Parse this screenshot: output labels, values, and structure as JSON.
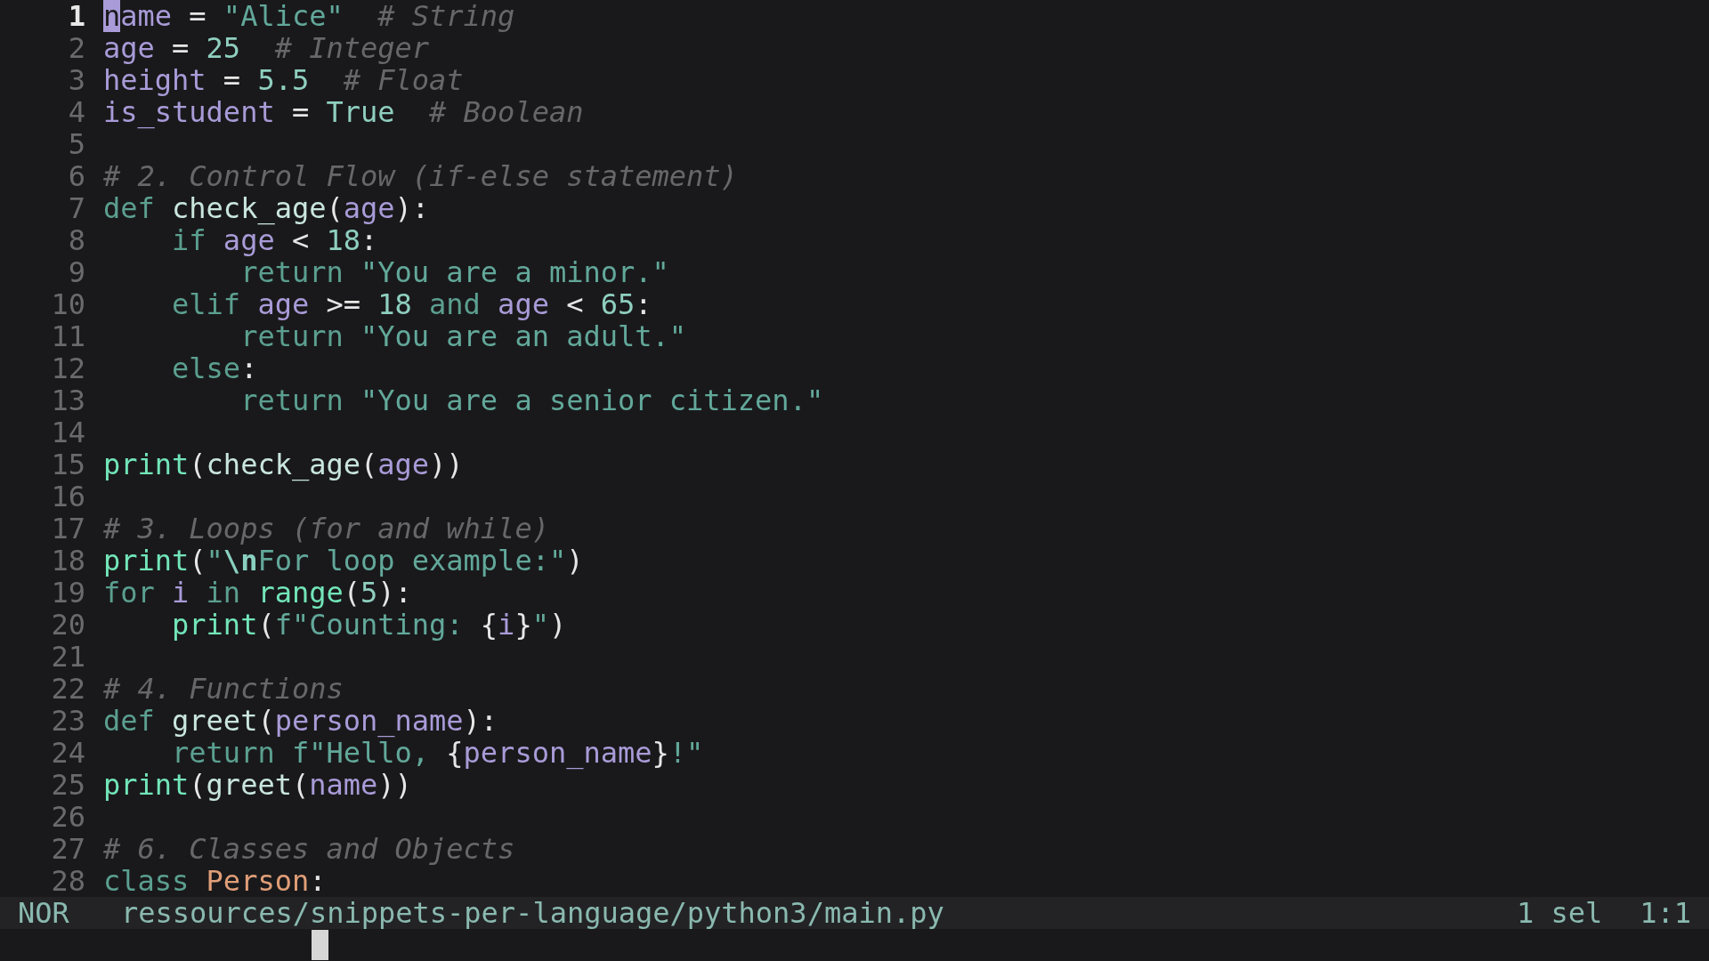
{
  "editor": {
    "lines": [
      {
        "number": "1",
        "current": true,
        "tokens": [
          {
            "text": "n",
            "kind": "cursor"
          },
          {
            "text": "ame",
            "kind": "var"
          },
          {
            "text": " =",
            "kind": "op"
          },
          {
            "text": " \"Alice\"",
            "kind": "str"
          },
          {
            "text": "  # String",
            "kind": "comment"
          }
        ]
      },
      {
        "number": "2",
        "current": false,
        "tokens": [
          {
            "text": "age",
            "kind": "var"
          },
          {
            "text": " =",
            "kind": "op"
          },
          {
            "text": " 25",
            "kind": "num"
          },
          {
            "text": "  # Integer",
            "kind": "comment"
          }
        ]
      },
      {
        "number": "3",
        "current": false,
        "tokens": [
          {
            "text": "height",
            "kind": "var"
          },
          {
            "text": " =",
            "kind": "op"
          },
          {
            "text": " 5.5",
            "kind": "num"
          },
          {
            "text": "  # Float",
            "kind": "comment"
          }
        ]
      },
      {
        "number": "4",
        "current": false,
        "tokens": [
          {
            "text": "is_student",
            "kind": "var"
          },
          {
            "text": " =",
            "kind": "op"
          },
          {
            "text": " True",
            "kind": "num"
          },
          {
            "text": "  # Boolean",
            "kind": "comment"
          }
        ]
      },
      {
        "number": "5",
        "current": false
      },
      {
        "number": "6",
        "current": false,
        "tokens": [
          {
            "text": "# 2. Control Flow (if-else statement)",
            "kind": "comment"
          }
        ]
      },
      {
        "number": "7",
        "current": false,
        "tokens": [
          {
            "text": "def",
            "kind": "kw"
          },
          {
            "text": " check_age",
            "kind": "fn"
          },
          {
            "text": "(",
            "kind": "punct"
          },
          {
            "text": "age",
            "kind": "var"
          },
          {
            "text": "):",
            "kind": "punct"
          }
        ]
      },
      {
        "number": "8",
        "current": false,
        "tokens": [
          {
            "text": "    if",
            "kind": "kw"
          },
          {
            "text": " age",
            "kind": "var"
          },
          {
            "text": " <",
            "kind": "op"
          },
          {
            "text": " 18",
            "kind": "num"
          },
          {
            "text": ":",
            "kind": "punct"
          }
        ]
      },
      {
        "number": "9",
        "current": false,
        "tokens": [
          {
            "text": "        return",
            "kind": "kw"
          },
          {
            "text": " \"You are a minor.\"",
            "kind": "str"
          }
        ]
      },
      {
        "number": "10",
        "current": false,
        "tokens": [
          {
            "text": "    elif",
            "kind": "kw"
          },
          {
            "text": " age",
            "kind": "var"
          },
          {
            "text": " >=",
            "kind": "op"
          },
          {
            "text": " 18",
            "kind": "num"
          },
          {
            "text": " and",
            "kind": "kw"
          },
          {
            "text": " age",
            "kind": "var"
          },
          {
            "text": " <",
            "kind": "op"
          },
          {
            "text": " 65",
            "kind": "num"
          },
          {
            "text": ":",
            "kind": "punct"
          }
        ]
      },
      {
        "number": "11",
        "current": false,
        "tokens": [
          {
            "text": "        return",
            "kind": "kw"
          },
          {
            "text": " \"You are an adult.\"",
            "kind": "str"
          }
        ]
      },
      {
        "number": "12",
        "current": false,
        "tokens": [
          {
            "text": "    else",
            "kind": "kw"
          },
          {
            "text": ":",
            "kind": "punct"
          }
        ]
      },
      {
        "number": "13",
        "current": false,
        "tokens": [
          {
            "text": "        return",
            "kind": "kw"
          },
          {
            "text": " \"You are a senior citizen.\"",
            "kind": "str"
          }
        ]
      },
      {
        "number": "14",
        "current": false
      },
      {
        "number": "15",
        "current": false,
        "tokens": [
          {
            "text": "print",
            "kind": "builtin"
          },
          {
            "text": "(",
            "kind": "punct"
          },
          {
            "text": "check_age",
            "kind": "fn"
          },
          {
            "text": "(",
            "kind": "punct"
          },
          {
            "text": "age",
            "kind": "var"
          },
          {
            "text": "))",
            "kind": "punct"
          }
        ]
      },
      {
        "number": "16",
        "current": false
      },
      {
        "number": "17",
        "current": false,
        "tokens": [
          {
            "text": "# 3. Loops (for and while)",
            "kind": "comment"
          }
        ]
      },
      {
        "number": "18",
        "current": false,
        "tokens": [
          {
            "text": "print",
            "kind": "builtin"
          },
          {
            "text": "(",
            "kind": "punct"
          },
          {
            "text": "\"",
            "kind": "str"
          },
          {
            "text": "\\n",
            "kind": "escape"
          },
          {
            "text": "For loop example:\"",
            "kind": "str"
          },
          {
            "text": ")",
            "kind": "punct"
          }
        ]
      },
      {
        "number": "19",
        "current": false,
        "tokens": [
          {
            "text": "for",
            "kind": "kw"
          },
          {
            "text": " i",
            "kind": "var"
          },
          {
            "text": " in",
            "kind": "kw"
          },
          {
            "text": " range",
            "kind": "builtin"
          },
          {
            "text": "(",
            "kind": "punct"
          },
          {
            "text": "5",
            "kind": "num"
          },
          {
            "text": "):",
            "kind": "punct"
          }
        ]
      },
      {
        "number": "20",
        "current": false,
        "tokens": [
          {
            "text": "    print",
            "kind": "builtin"
          },
          {
            "text": "(",
            "kind": "punct"
          },
          {
            "text": "f\"Counting: ",
            "kind": "str"
          },
          {
            "text": "{",
            "kind": "punct"
          },
          {
            "text": "i",
            "kind": "var"
          },
          {
            "text": "}",
            "kind": "punct"
          },
          {
            "text": "\"",
            "kind": "str"
          },
          {
            "text": ")",
            "kind": "punct"
          }
        ]
      },
      {
        "number": "21",
        "current": false
      },
      {
        "number": "22",
        "current": false,
        "tokens": [
          {
            "text": "# 4. Functions",
            "kind": "comment"
          }
        ]
      },
      {
        "number": "23",
        "current": false,
        "tokens": [
          {
            "text": "def",
            "kind": "kw"
          },
          {
            "text": " greet",
            "kind": "fn"
          },
          {
            "text": "(",
            "kind": "punct"
          },
          {
            "text": "person_name",
            "kind": "var"
          },
          {
            "text": "):",
            "kind": "punct"
          }
        ]
      },
      {
        "number": "24",
        "current": false,
        "tokens": [
          {
            "text": "    return",
            "kind": "kw"
          },
          {
            "text": " f\"Hello, ",
            "kind": "str"
          },
          {
            "text": "{",
            "kind": "punct"
          },
          {
            "text": "person_name",
            "kind": "var"
          },
          {
            "text": "}",
            "kind": "punct"
          },
          {
            "text": "!\"",
            "kind": "str"
          }
        ]
      },
      {
        "number": "25",
        "current": false,
        "tokens": [
          {
            "text": "print",
            "kind": "builtin"
          },
          {
            "text": "(",
            "kind": "punct"
          },
          {
            "text": "greet",
            "kind": "fn"
          },
          {
            "text": "(",
            "kind": "punct"
          },
          {
            "text": "name",
            "kind": "var"
          },
          {
            "text": "))",
            "kind": "punct"
          }
        ]
      },
      {
        "number": "26",
        "current": false
      },
      {
        "number": "27",
        "current": false,
        "tokens": [
          {
            "text": "# 6. Classes and Objects",
            "kind": "comment"
          }
        ]
      },
      {
        "number": "28",
        "current": false,
        "tokens": [
          {
            "text": "class",
            "kind": "kw"
          },
          {
            "text": " Person",
            "kind": "type"
          },
          {
            "text": ":",
            "kind": "punct"
          }
        ]
      }
    ]
  },
  "status_bar": {
    "mode": "NOR",
    "file_path": "ressources/snippets-per-language/python3/main.py",
    "selections": "1 sel",
    "position": "1:1"
  }
}
